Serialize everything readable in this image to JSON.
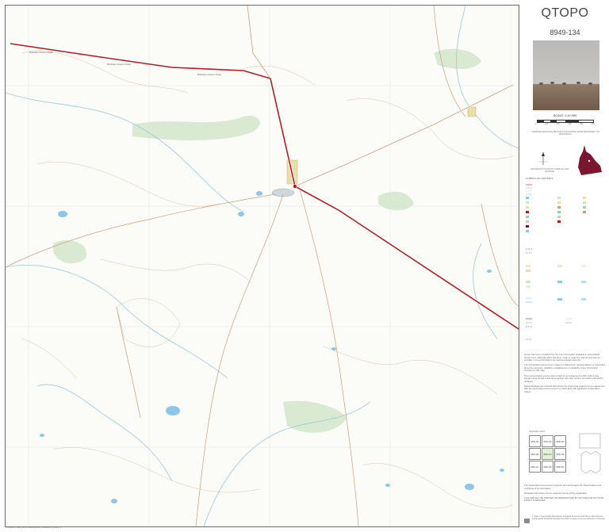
{
  "map": {
    "title": "QTOPO",
    "sheet_number": "8949-134",
    "scale": "SCALE 1:10,000",
    "scale_ticks": [
      "0",
      "100",
      "200",
      "400",
      "600",
      "800"
    ],
    "colors": {
      "major_road": "#c0161d",
      "road_halo": "#ffffff",
      "minor_track": "#c9a07a",
      "contour": "#d7c6ae",
      "stream": "#9fc7d8",
      "water": "#8cc6e8",
      "vegetation": "#cfe3c5",
      "grid": "#dbe6ec",
      "urban": "#e9e0a8",
      "state_fill": "#7a1630"
    },
    "road_labels": [
      "Brisbane Downs Road",
      "Brisbane Downs Road",
      "Brisbane Downs Road"
    ],
    "locality_icon": "town-marker-icon"
  },
  "sidebar": {
    "locality_diagram_title": "LOCALITY DIAGRAM",
    "credits_text": "COMPILED FROM AVAILABLE DATA AND MAPPING FROM DEPARTMENT OF RESOURCES",
    "datum": "GEOCENTRIC DATUM OF AUSTRALIA 2020 (GDA2020)",
    "legend_title": "SYMBOLS OF CONTENTS",
    "legend_sections": [
      "ROADS",
      "BOUNDARIES",
      "LAND USE",
      "LAND COVER",
      "HYDROGRAPHY",
      "TRANSPORTATION",
      "RELIEF",
      "ADMINISTRATIVE"
    ],
    "disclaimer": [
      "QTopo has been compiled from the best information available to Queensland Government. Although effort has been made to make the map as accurate as possible, it is not intended to be used as a legal reference.",
      "The Queensland Government makes no statements, representations or warranties about the accuracy, reliability, completeness or suitability of any information included on this map.",
      "The representation of any road or track is not evidence of public right of way. People using private roads do so at their own risk; owners' permission should be obtained.",
      "Nature Refuges are freehold land where the owner has entered into an agreement with the Queensland Government to protect land with significant conservation values."
    ],
    "index_title": "ADJOINING MAPS",
    "index_sheets": [
      "8949-131",
      "8949-132",
      "8949-133",
      "8949-135",
      "8949-134",
      "8949-136",
      "8949-141",
      "8949-142",
      "8949-143"
    ],
    "feedback": "The Queensland Government supports and encourages the dissemination and exchange of its information.",
    "more_info": "Metadata information can be obtained via the QTopo application.",
    "not_for_sale": "THIS MAP MAY BE PRINTED OR REPRODUCED BY ANYONE FOR NOT FOR PROFIT PURPOSES",
    "copyright": "© State of Queensland (Department of Natural Resources and Mines, Manufacturing and Regional and Rural Development) 2025. Creative Commons Attribution 4.0 licence.",
    "bottom_note": "Projection: Map Grid of Australia 2020 (MGA2020), Zone 55"
  }
}
